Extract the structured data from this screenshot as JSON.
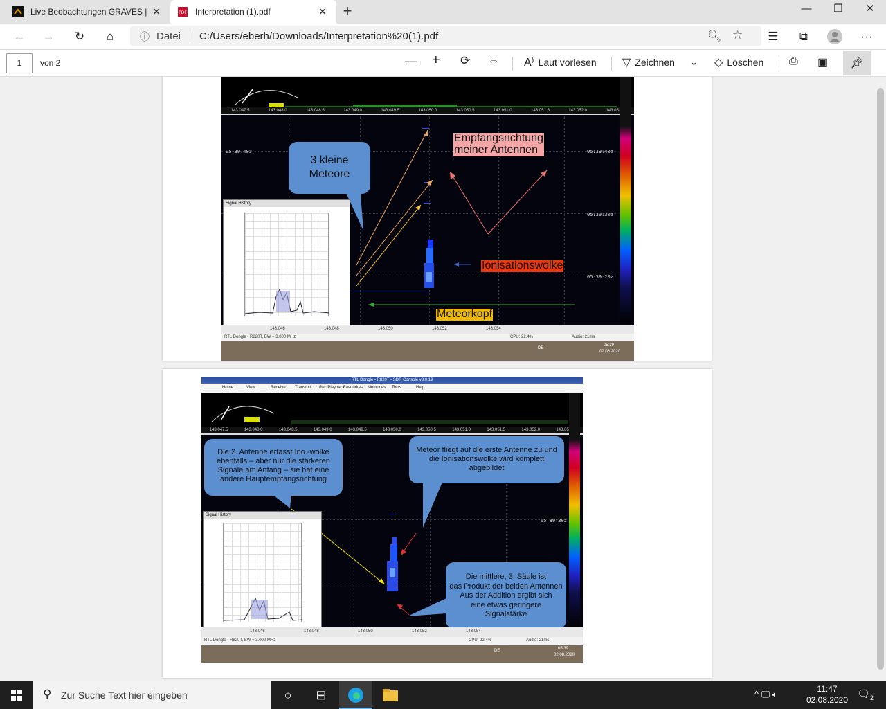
{
  "browser": {
    "tabs": [
      {
        "title": "Live Beobachtungen GRAVES | Se"
      },
      {
        "title": "Interpretation (1).pdf"
      }
    ],
    "address": {
      "label": "Datei",
      "url": "C:/Users/eberh/Downloads/Interpretation%20(1).pdf"
    }
  },
  "pdf_toolbar": {
    "page": "1",
    "of_pages": "von 2",
    "read_aloud": "Laut vorlesen",
    "draw": "Zeichnen",
    "erase": "Löschen"
  },
  "page1": {
    "callout_meteors": "3 kleine Meteore",
    "label_direction_line1": "Empfangsrichtung",
    "label_direction_line2": "meiner Antennen",
    "label_ionisation": "Ionisationswolke",
    "label_meteorhead": "Meteorkopf",
    "timestamps": [
      "05:39:40z",
      "05:39:40z",
      "05:39:30z",
      "05:39:20z"
    ],
    "freq_ticks": [
      "143.047.5",
      "143.048.0",
      "143.048.5",
      "143.049.0",
      "143.049.5",
      "143.050.0",
      "143.050.5",
      "143.051.0",
      "143.051.5",
      "143.052.0",
      "143.052.5"
    ],
    "bottom_freqs": [
      "143.046",
      "143.048",
      "143.050",
      "143.052",
      "143.054"
    ],
    "status_left": "RTL Dongle - R820T, BW = 3.000 MHz",
    "status_cpu": "CPU: 22.4%",
    "status_audio": "Audio: 21ms",
    "signal_history": "Signal History",
    "clock": "05:39",
    "date": "02.08.2020",
    "lang": "DE"
  },
  "page2": {
    "window_title": "RTL Dongle - R820T - SDR Console v3.0.19",
    "menu": [
      "Home",
      "View",
      "Receive",
      "Transmit",
      "Rec/Playback",
      "Favourites",
      "Memories",
      "Tools",
      "Help"
    ],
    "callout_antenna2": "Die 2. Antenne erfasst Ino.-wolke ebenfalls – aber nur die stärkeren Signale am Anfang – sie hat eine andere Hauptempfangsrichtung",
    "callout_first": "Meteor fliegt auf die erste Antenne zu und die Ionisationswolke wird komplett abgebildet",
    "callout_third_l1": "Die mittlere, 3. Säule ist",
    "callout_third_l2": "das Produkt der beiden Antennen",
    "callout_third_l3": "Aus der Addition ergibt sich",
    "callout_third_l4": "eine etwas geringere",
    "callout_third_l5": "Signalstärke",
    "timestamp": "05:39:30z",
    "signal_history": "Signal History",
    "status_left": "RTL Dongle - R820T, BW = 3.000 MHz",
    "status_cpu": "CPU: 22.4%",
    "status_audio": "Audio: 21ms",
    "clock": "05:39",
    "date": "02.08.2020",
    "lang": "DE",
    "bottom_freqs": [
      "143.046",
      "143.048",
      "143.050",
      "143.052",
      "143.054"
    ]
  },
  "taskbar": {
    "search_placeholder": "Zur Suche Text hier eingeben",
    "time": "11:47",
    "date": "02.08.2020",
    "notifications": "2"
  }
}
